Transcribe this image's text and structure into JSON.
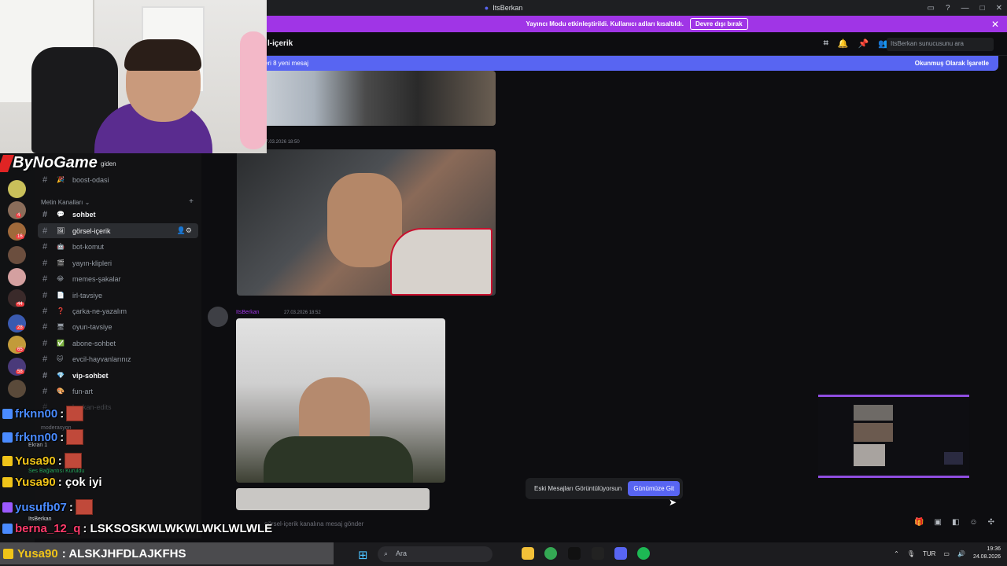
{
  "window": {
    "title": "ItsBerkan"
  },
  "banner": {
    "text": "Yayıncı Modu etkinleştirildi. Kullanıcı adları kısaltıldı.",
    "button": "Devre dışı bırak"
  },
  "header": {
    "channel": "l-içerik",
    "search_placeholder": "ItsBerkan sunucusunu ara"
  },
  "new_messages": {
    "left": "eri 8 yeni mesaj",
    "right": "Okunmuş Olarak İşaretle"
  },
  "overlay": {
    "brand": "ByNoGame"
  },
  "sidebar": {
    "top_label": "giden",
    "channels_top": [
      {
        "name": "boost-odasi",
        "emoji": "🎉"
      }
    ],
    "category": "Metin Kanalları",
    "channels": [
      {
        "name": "sohbet",
        "emoji": "💬",
        "bold": true
      },
      {
        "name": "görsel-içerik",
        "emoji": "🖼",
        "active": true
      },
      {
        "name": "bot-komut",
        "emoji": "🤖"
      },
      {
        "name": "yayın-klipleri",
        "emoji": "🎬"
      },
      {
        "name": "memes-şakalar",
        "emoji": "😂"
      },
      {
        "name": "irl-tavsiye",
        "emoji": "📄"
      },
      {
        "name": "çarka-ne-yazalım",
        "emoji": "❓"
      },
      {
        "name": "oyun-tavsiye",
        "emoji": "🖥"
      },
      {
        "name": "abone-sohbet",
        "emoji": "✅"
      },
      {
        "name": "evcil-hayvanlarınız",
        "emoji": "🐱"
      },
      {
        "name": "vip-sohbet",
        "emoji": "💎",
        "bold": true
      },
      {
        "name": "fun-art",
        "emoji": "🎨"
      },
      {
        "name": "berkan-edits",
        "emoji": ""
      }
    ],
    "moderasyon": "moderasyon",
    "screen_label": "Ekran 1",
    "voice_status": "Ses Bağlantısı Kuruldu",
    "user": "ItsBerkan"
  },
  "stream_chat": [
    {
      "user": "frknn00",
      "text": ":",
      "color": "#4a8bff"
    },
    {
      "user": "frknn00",
      "text": ":",
      "color": "#4a8bff"
    },
    {
      "user": "Yusa90",
      "text": ":",
      "color": "#f0c419"
    },
    {
      "user": "Yusa90",
      "text": ": çok iyi",
      "color": "#f0c419"
    },
    {
      "user": "yusufb07",
      "text": ":",
      "color": "#4a8bff"
    },
    {
      "user": "berna_12_q",
      "text": ": LSKSOSKWLWKWLWKLWLWLE",
      "color": "#ff3b6b"
    },
    {
      "user": "Yusa90",
      "text": ": ALSKJHFDLAJKFHS",
      "color": "#f0c419"
    }
  ],
  "messages": [
    {
      "time": "27.03.2026 18:50"
    },
    {
      "user": "ItsBerkan",
      "time": "27.03.2026 18:52"
    }
  ],
  "toast": {
    "text": "Eski Mesajları Görüntülüyorsun",
    "button": "Günümüze Git"
  },
  "composer": {
    "placeholder": "görsel-içerik kanalına mesaj gönder"
  },
  "taskbar": {
    "search": "Ara",
    "lang": "TUR",
    "time": "19:36",
    "date": "24.08.2026"
  },
  "server_badges": [
    "4",
    "16",
    "44",
    "28",
    "65",
    "58"
  ]
}
